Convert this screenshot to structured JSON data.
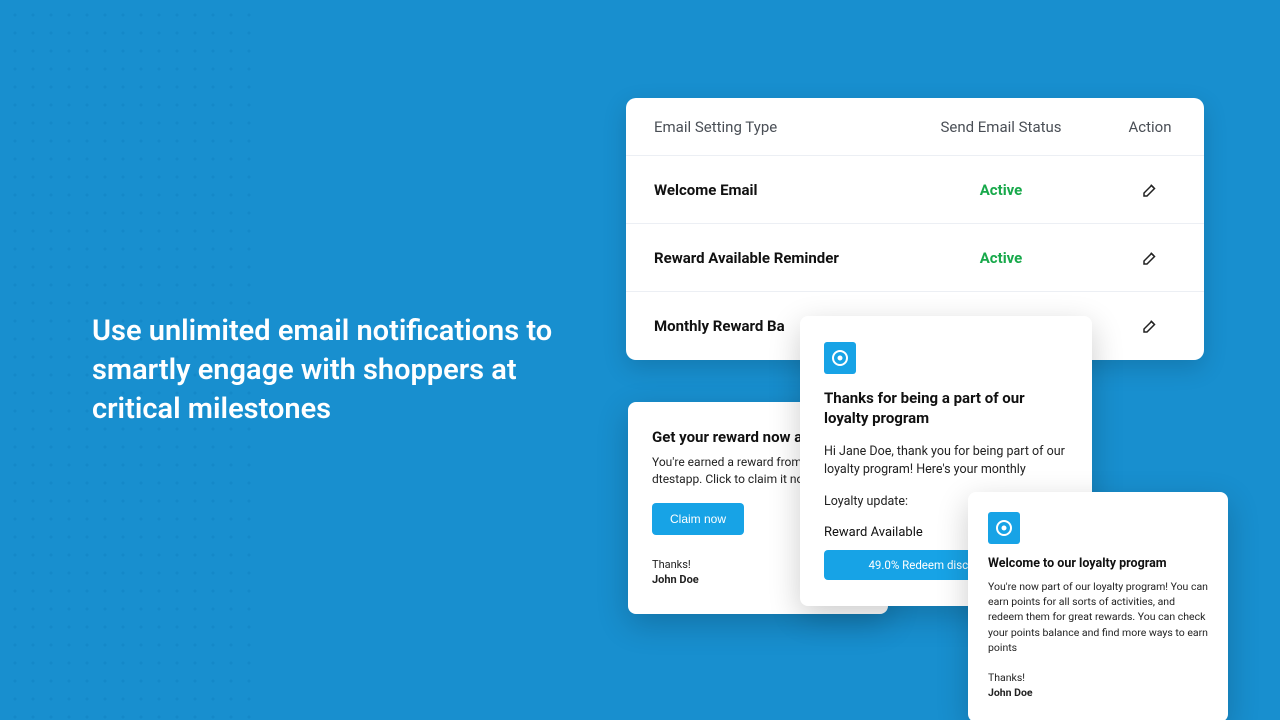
{
  "headline": "Use unlimited email notifications to smartly engage with shoppers at critical milestones",
  "table": {
    "headers": {
      "col1": "Email Setting Type",
      "col2": "Send Email Status",
      "col3": "Action"
    },
    "rows": [
      {
        "type": "Welcome Email",
        "status": "Active"
      },
      {
        "type": "Reward  Available Reminder",
        "status": "Active"
      },
      {
        "type": "Monthly Reward Ba",
        "status": ""
      }
    ]
  },
  "cardA": {
    "title": "Get your reward now a",
    "body": "You're earned a reward from program at dtestapp. Click to claim it now!",
    "cta": "Claim now",
    "thanks": "Thanks!",
    "signer": "John Doe"
  },
  "cardB": {
    "title": "Thanks for being a part of our loyalty program",
    "greeting": "Hi Jane Doe, thank you for being part of our loyalty program! Here's your monthly",
    "updateLabel": "Loyalty update:",
    "rewardLabel": "Reward Available",
    "rewardText": "49.0% Redeem discount 98 Po"
  },
  "cardC": {
    "title": "Welcome to our loyalty program",
    "body": "You're now part of our loyalty program! You can earn points for all sorts of activities, and redeem them for great rewards. You can check your points balance and find more ways to earn points",
    "thanks": "Thanks!",
    "signer": "John Doe"
  }
}
